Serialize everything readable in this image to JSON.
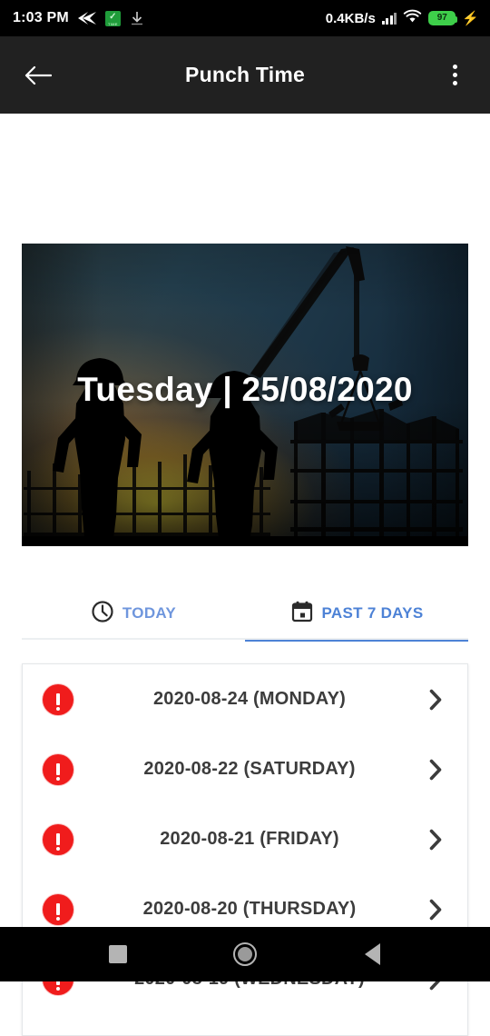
{
  "status_bar": {
    "time": "1:03 PM",
    "network_speed": "0.4KB/s",
    "battery_percent": "97",
    "icons": [
      "send-icon",
      "time-app-icon",
      "download-icon",
      "signal-icon",
      "wifi-icon",
      "battery-icon",
      "charging-bolt-icon"
    ],
    "app_icon_label": "TIME"
  },
  "app_bar": {
    "title": "Punch Time",
    "back_icon": "back-arrow-icon",
    "overflow_icon": "more-vertical-icon"
  },
  "banner": {
    "title": "Tuesday | 25/08/2020",
    "alt": "construction site silhouette at sunset with crane and two workers"
  },
  "tabs": [
    {
      "id": "today",
      "label": "TODAY",
      "icon": "clock-icon",
      "active": false
    },
    {
      "id": "past-7-days",
      "label": "PAST 7 DAYS",
      "icon": "calendar-icon",
      "active": true
    }
  ],
  "list": {
    "rows": [
      {
        "status_icon": "alert-circle-icon",
        "label": "2020-08-24 (MONDAY)",
        "chevron": "chevron-right-icon"
      },
      {
        "status_icon": "alert-circle-icon",
        "label": "2020-08-22 (SATURDAY)",
        "chevron": "chevron-right-icon"
      },
      {
        "status_icon": "alert-circle-icon",
        "label": "2020-08-21 (FRIDAY)",
        "chevron": "chevron-right-icon"
      },
      {
        "status_icon": "alert-circle-icon",
        "label": "2020-08-20 (THURSDAY)",
        "chevron": "chevron-right-icon"
      },
      {
        "status_icon": "alert-circle-icon",
        "label": "2020-08-19 (WEDNESDAY)",
        "chevron": "chevron-right-icon"
      }
    ]
  },
  "nav_bar": {
    "recents_icon": "square-recents-icon",
    "home_icon": "circle-home-icon",
    "back_icon": "triangle-back-icon"
  },
  "colors": {
    "accent_blue": "#4d82d6",
    "alert_red": "#f01c1c",
    "app_bar_bg": "#212121",
    "battery_green": "#3ecf4a"
  }
}
